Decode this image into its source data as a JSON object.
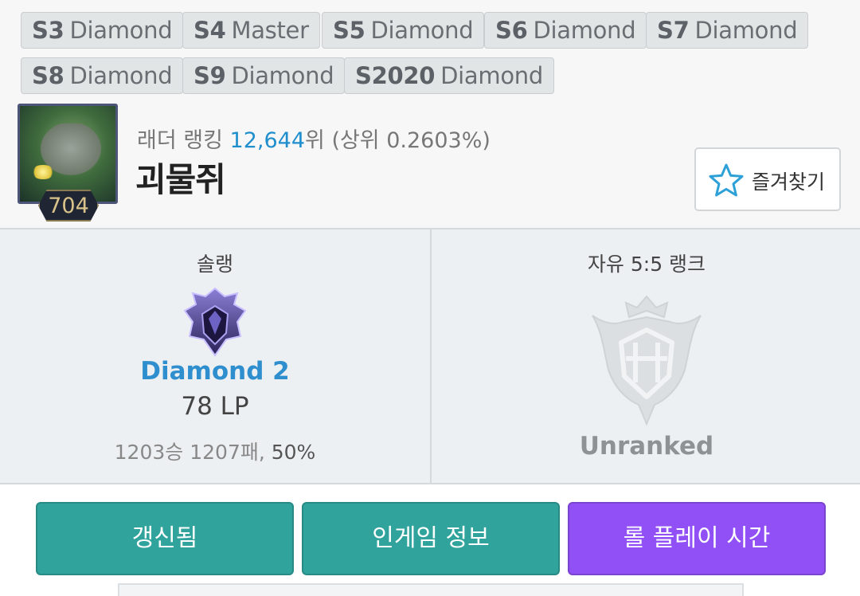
{
  "past_seasons": [
    {
      "season": "S3",
      "tier": "Diamond"
    },
    {
      "season": "S4",
      "tier": "Master"
    },
    {
      "season": "S5",
      "tier": "Diamond"
    },
    {
      "season": "S6",
      "tier": "Diamond"
    },
    {
      "season": "S7",
      "tier": "Diamond"
    },
    {
      "season": "S8",
      "tier": "Diamond"
    },
    {
      "season": "S9",
      "tier": "Diamond"
    },
    {
      "season": "S2020",
      "tier": "Diamond"
    }
  ],
  "profile": {
    "level": "704",
    "ladder_prefix": "래더 랭킹 ",
    "ladder_rank": "12,644",
    "ladder_suffix": "위 (상위 0.2603%)",
    "summoner_name": "괴물쥐",
    "favorite_label": "즐겨찾기",
    "icons": {
      "favorite": "star-outline-icon"
    }
  },
  "solo_rank": {
    "title": "솔랭",
    "tier": "Diamond 2",
    "lp": "78 LP",
    "record": "1203승 1207패, ",
    "win_rate": "50%"
  },
  "flex_rank": {
    "title": "자유 5:5 랭크",
    "tier": "Unranked"
  },
  "actions": {
    "refresh": "갱신됨",
    "ingame": "인게임 정보",
    "playtime": "롤 플레이 시간"
  },
  "colors": {
    "accent_blue": "#2f8fce",
    "teal_button": "#30a39c",
    "purple_button": "#9150f5"
  }
}
